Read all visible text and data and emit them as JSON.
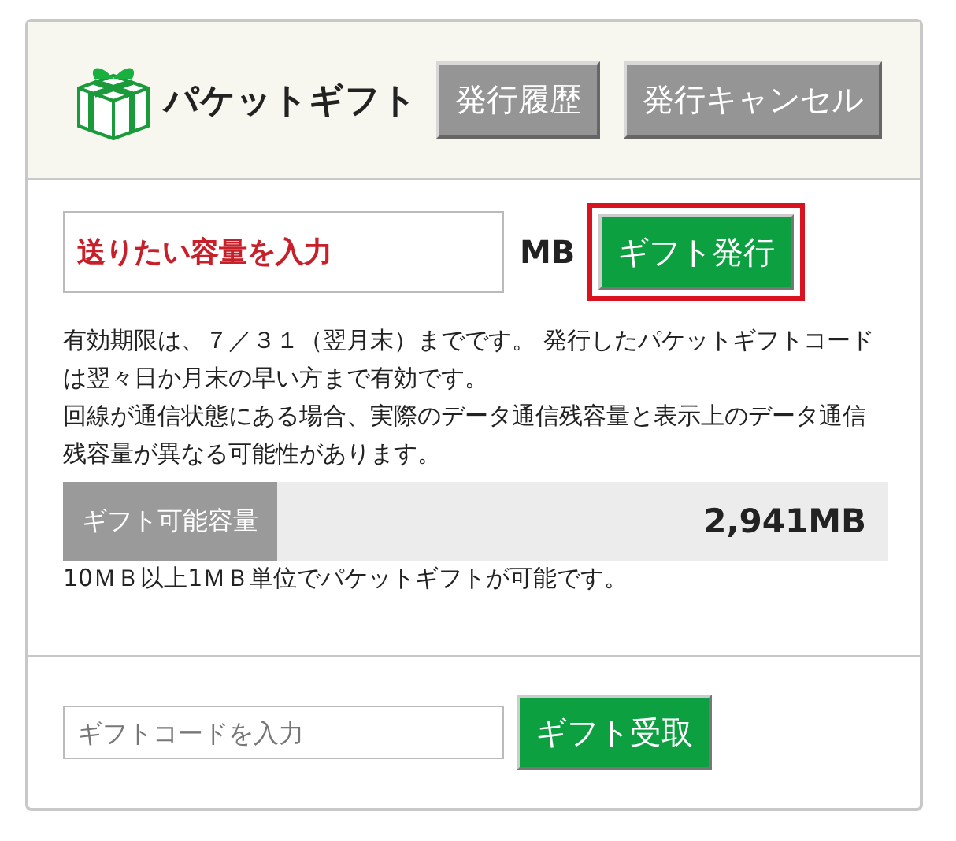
{
  "header": {
    "title": "パケットギフト",
    "buttons": [
      "発行履歴",
      "発行キャンセル"
    ]
  },
  "issue": {
    "placeholder": "送りたい容量を入力",
    "unit": "MB",
    "button": {
      "label": "ギフト発行",
      "highlighted": true
    }
  },
  "notes": [
    "有効期限は、７／３１（翌月末）までです。 発行したパケットギフトコードは翌々日か月末の早い方まで有効です。",
    "回線が通信状態にある場合、実際のデータ通信残容量と表示上のデータ通信残容量が異なる可能性があります。"
  ],
  "capacity": {
    "label": "ギフト可能容量",
    "value": "2,941MB",
    "note": "10ＭＢ以上1ＭＢ単位でパケットギフトが可能です。"
  },
  "receive": {
    "placeholder": "ギフトコードを入力",
    "button": "ギフト受取"
  }
}
